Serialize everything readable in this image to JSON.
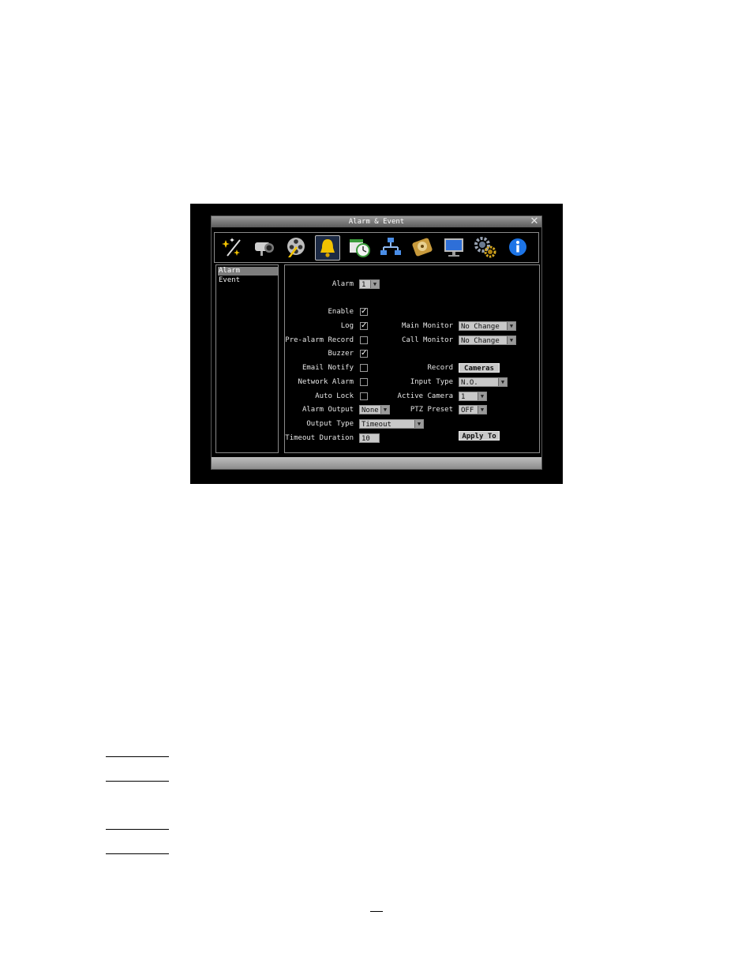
{
  "window": {
    "title": "Alarm & Event",
    "close": "✕"
  },
  "toolbar": {
    "icons": [
      "wizard-icon",
      "camera-icon",
      "film-reel-icon",
      "bell-icon",
      "schedule-icon",
      "network-icon",
      "disk-icon",
      "monitor-icon",
      "gears-icon",
      "info-icon"
    ],
    "selected": "bell-icon"
  },
  "sidebar": {
    "items": [
      {
        "label": "Alarm",
        "active": true
      },
      {
        "label": "Event",
        "active": false
      }
    ]
  },
  "form": {
    "alarm_label": "Alarm",
    "alarm_value": "1",
    "enable_label": "Enable",
    "enable_checked": "✓",
    "log_label": "Log",
    "log_checked": "✓",
    "prealarm_label": "Pre-alarm Record",
    "prealarm_checked": "",
    "buzzer_label": "Buzzer",
    "buzzer_checked": "✓",
    "email_label": "Email Notify",
    "email_checked": "",
    "network_label": "Network Alarm",
    "network_checked": "",
    "autolock_label": "Auto Lock",
    "autolock_checked": "",
    "alarm_output_label": "Alarm Output",
    "alarm_output_value": "None",
    "output_type_label": "Output Type",
    "output_type_value": "Timeout",
    "timeout_label": "Timeout Duration",
    "timeout_value": "10",
    "main_monitor_label": "Main Monitor",
    "main_monitor_value": "No Change",
    "call_monitor_label": "Call Monitor",
    "call_monitor_value": "No Change",
    "record_label": "Record",
    "record_button": "Cameras",
    "input_type_label": "Input Type",
    "input_type_value": "N.O.",
    "active_camera_label": "Active Camera",
    "active_camera_value": "1",
    "ptz_label": "PTZ Preset",
    "ptz_value": "OFF",
    "apply_to": "Apply To"
  },
  "colors": {
    "screen_bg": "#000000",
    "selected_item": "#7d7d7d",
    "field_bg": "#c8c8c8"
  }
}
